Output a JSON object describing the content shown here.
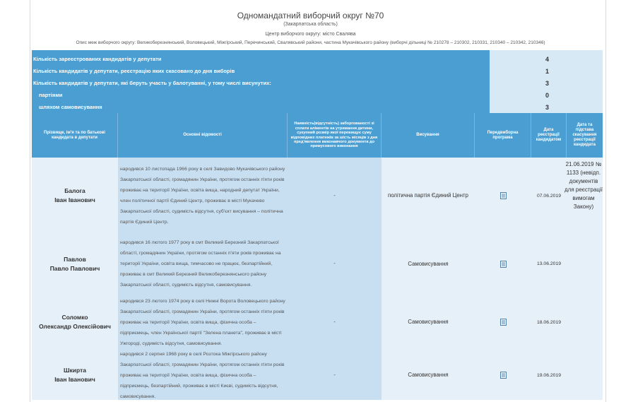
{
  "header": {
    "title": "Одномандатний виборчий округ №70",
    "region": "(Закарпатська область)",
    "center": "Центр виборчого округу: місто Свалява",
    "description": "Опис меж виборчого округу: Великоберезнянський, Воловецький, Міжгірський, Перечинський, Свалявський райони, частина Мукачівського району (виборчі дільниці № 210278 – 210302, 210331, 210340 – 210342, 210346)"
  },
  "summary": [
    {
      "label": "Кількість зареєстрованих кандидатів у депутати",
      "value": "4"
    },
    {
      "label": "Кількість кандидатів у депутати, реєстрацію яких скасовано до дня виборів",
      "value": "1"
    },
    {
      "label": "Кількість кандидатів у депутати, які беруть участь у балотуванні, у тому числі висунутих:",
      "value": "3"
    },
    {
      "label": "партіями",
      "value": "0"
    },
    {
      "label": "шляхом самовисування",
      "value": "3"
    }
  ],
  "columns": {
    "name": "Прізвище, ім'я та по батькові кандидата в депутати",
    "info": "Основні відомості",
    "money": "Наявність(відсутність) заборгованості зі сплати аліментів на утримання дитини, сукупний розмір якої перевищує суму відповідних платежів за шість місяців з дня пред'явлення виконавчого документа до примусового виконання",
    "nomination": "Висування",
    "program": "Передвиборна програма",
    "reg_date": "Дата реєстрації кандидатом",
    "status": "Дата та підстава скасування реєстрації кандидата"
  },
  "candidates": [
    {
      "surname": "Балога",
      "given": "Іван Іванович",
      "info": "народився 10 листопада 1966 року в селі Завидово Мукачівського району Закарпатської області, громадянин України, протягом останніх п'яти років проживає на території України, освіта вища, народний депутат України, член політичної партії Єдиний Центр, проживає в місті Мукачево Закарпатської області, судимість відсутня, суб'єкт висування – політична партія Єдиний Центр.",
      "money": "-",
      "nomination": "політична партія Єдиний Центр",
      "reg_date": "07.06.2019"
    },
    {
      "surname": "Павлов",
      "given": "Павло Павлович",
      "info": "народився 16 лютого 1977 року в смт Великий Березний Закарпатської області, громадянин України, протягом останніх п'яти років проживає на території України, освіта вища, тимчасово не працює, безпартійний, проживає в смт Великий Березний Великоберезнянського району Закарпатської області, судимість відсутня, самовисування.",
      "money": "-",
      "nomination": "Самовисування",
      "reg_date": "13.06.2019"
    },
    {
      "surname": "Соломко",
      "given": "Олександр Олексійович",
      "info": "народився 23 лютого 1974 року в селі Нижні Ворота Воловецького району Закарпатської області, громадянин України, протягом останніх п'яти років проживає на території України, освіта вища, фізична особа – підприємець, член Української партії \"Зелена планета\", проживає в місті Ужгороді, судимість відсутня, самовисування.",
      "money": "-",
      "nomination": "Самовисування",
      "reg_date": "18.06.2019"
    },
    {
      "surname": "Шкирта",
      "given": "Іван Іванович",
      "info": "народився 2 серпня 1968 року в селі Розтока Міжгірського району Закарпатської області, громадянин України, протягом останніх п'яти років проживає на території України, освіта вища, фізична особа – підприємець, безпартійний, проживає в місті Києві, судимість відсутня, самовисування.",
      "money": "-",
      "nomination": "Самовисування",
      "reg_date": "19.06.2019"
    }
  ],
  "cancellation": "21.06.2019 № 1133 (невідп. документів для реєстрації вимогам Закону)",
  "icons": {
    "program": "document-icon"
  },
  "colors": {
    "header_bg": "#4a9ed2",
    "value_bg": "#d8e9f6",
    "info_bg": "#c8dff2",
    "cell_bg": "#e6f0f8"
  }
}
